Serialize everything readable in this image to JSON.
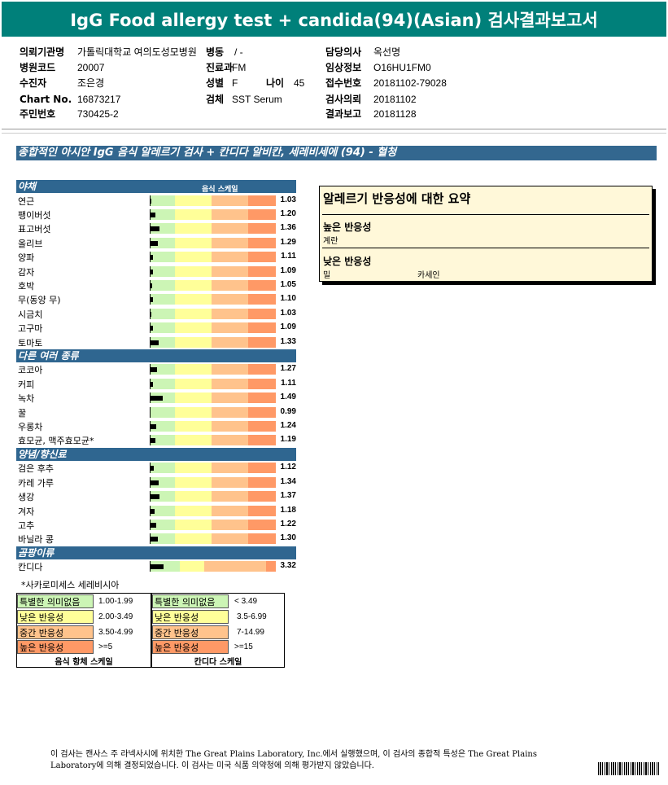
{
  "header": {
    "title": "IgG Food allergy test + candida(94)(Asian) 검사결과보고서"
  },
  "info": {
    "col1": [
      {
        "label": "의뢰기관명",
        "value": "가톨릭대학교 여의도성모병원"
      },
      {
        "label": "병원코드",
        "value": "20007"
      },
      {
        "label": "수진자",
        "value": "조은경"
      },
      {
        "label": "Chart No.",
        "value": "16873217"
      },
      {
        "label": "주민번호",
        "value": "730425-2"
      }
    ],
    "ward": {
      "label": "병동",
      "value": "/ -"
    },
    "dept": {
      "label": "진료과",
      "value": "FM"
    },
    "sex": {
      "label": "성별",
      "value": "F"
    },
    "age": {
      "label": "나이",
      "value": "45"
    },
    "specimen": {
      "label": "검체",
      "value": "SST Serum"
    },
    "col3": [
      {
        "label": "담당의사",
        "value": "옥선명"
      },
      {
        "label": "임상정보",
        "value": "O16HU1FM0"
      },
      {
        "label": "접수번호",
        "value": "20181102-79028"
      },
      {
        "label": "검사의뢰",
        "value": "20181102"
      },
      {
        "label": "결과보고",
        "value": "20181128"
      }
    ]
  },
  "banner": "종합적인 아시안 IgG 음식 알레르기 검사 + 칸디다 알비칸, 세레비세에 (94) - 혈청",
  "scale_title": "음식 스케일",
  "categories": [
    {
      "name": "야채",
      "items": [
        {
          "name": "연근",
          "value": "1.03"
        },
        {
          "name": "팽이버섯",
          "value": "1.20"
        },
        {
          "name": "표고버섯",
          "value": "1.36"
        },
        {
          "name": "올리브",
          "value": "1.29"
        },
        {
          "name": "양파",
          "value": "1.11"
        },
        {
          "name": "감자",
          "value": "1.09"
        },
        {
          "name": "호박",
          "value": "1.05"
        },
        {
          "name": "무(동양 무)",
          "value": "1.10"
        },
        {
          "name": "시금치",
          "value": "1.03"
        },
        {
          "name": "고구마",
          "value": "1.09"
        },
        {
          "name": "토마토",
          "value": "1.33"
        }
      ]
    },
    {
      "name": "다른 여러 종류",
      "items": [
        {
          "name": "코코아",
          "value": "1.27"
        },
        {
          "name": "커피",
          "value": "1.11"
        },
        {
          "name": "녹차",
          "value": "1.49"
        },
        {
          "name": "꿀",
          "value": "0.99"
        },
        {
          "name": "우롱차",
          "value": "1.24"
        },
        {
          "name": "효모균, 맥주효모균*",
          "value": "1.19"
        }
      ]
    },
    {
      "name": "양념/향신료",
      "items": [
        {
          "name": "검은 후추",
          "value": "1.12"
        },
        {
          "name": "카레 가루",
          "value": "1.34"
        },
        {
          "name": "생강",
          "value": "1.37"
        },
        {
          "name": "겨자",
          "value": "1.18"
        },
        {
          "name": "고추",
          "value": "1.22"
        },
        {
          "name": "바닐라 콩",
          "value": "1.30"
        }
      ]
    },
    {
      "name": "곰팡이류",
      "items": [
        {
          "name": "칸디다",
          "value": "3.32"
        }
      ]
    }
  ],
  "footnote": "*사카로미세스 세레비시아",
  "legend": {
    "food": {
      "title": "음식 항체 스케일",
      "rows": [
        {
          "label": "특별한 의미없음",
          "range": "1.00-1.99",
          "color": "#ccf5b5"
        },
        {
          "label": "낮은 반응성",
          "range": "2.00-3.49",
          "color": "#ffff99"
        },
        {
          "label": "중간 반응성",
          "range": "3.50-4.99",
          "color": "#ffc38c"
        },
        {
          "label": "높은 반응성",
          "range": ">=5",
          "color": "#ff9966"
        }
      ]
    },
    "candida": {
      "title": "칸디다 스케일",
      "rows": [
        {
          "label": "특별한 의미없음",
          "range": "< 3.49",
          "color": "#ccf5b5"
        },
        {
          "label": "낮은 반응성",
          "range": "3.5-6.99",
          "color": "#ffff99"
        },
        {
          "label": "중간 반응성",
          "range": "7-14.99",
          "color": "#ffc38c"
        },
        {
          "label": "높은 반응성",
          "range": ">=15",
          "color": "#ff9966"
        }
      ]
    }
  },
  "summary": {
    "title": "알레르기 반응성에 대한 요약",
    "high_label": "높은 반응성",
    "high_items": [
      "계란"
    ],
    "low_label": "낮은 반응성",
    "low_items": [
      "밀",
      "카세인"
    ]
  },
  "disclaimer": "이 검사는 캔사스 주 라넥사시에 위치한 The Great Plains Laboratory, Inc.에서 실행했으며, 이 검사의 종합적 특성은 The Great Plains Laboratory에 의해 결정되었습니다. 이 검사는 미국 식품 의약청에 의해 평가받지 않았습니다."
}
